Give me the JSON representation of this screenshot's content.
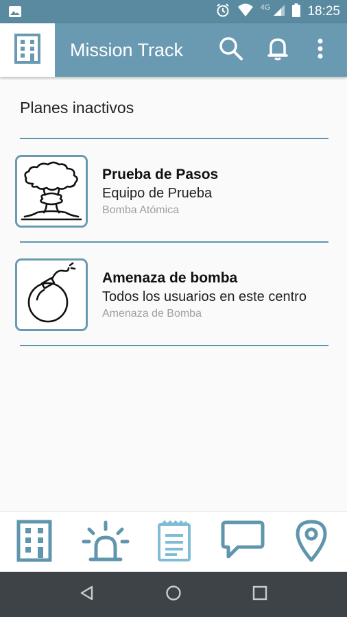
{
  "status_bar": {
    "time": "18:25",
    "network": "4G",
    "icons": [
      "image-notification-icon",
      "alarm-icon",
      "wifi-icon",
      "signal-icon",
      "battery-icon"
    ]
  },
  "app_bar": {
    "title": "Mission Track",
    "logo_icon": "building-icon",
    "actions": [
      "search-icon",
      "bell-icon",
      "more-vert-icon"
    ],
    "background": "#6a9ab2"
  },
  "section": {
    "title": "Planes inactivos"
  },
  "plans": [
    {
      "name": "Prueba de Pasos",
      "team": "Equipo de Prueba",
      "type": "Bomba Atómica",
      "icon": "nuclear-explosion-icon"
    },
    {
      "name": "Amenaza de bomba",
      "team": "Todos los usuarios en este centro",
      "type": "Amenaza de Bomba",
      "icon": "bomb-icon"
    }
  ],
  "bottom_nav": {
    "items": [
      "building-icon",
      "alarm-light-icon",
      "clipboard-icon",
      "chat-icon",
      "location-pin-icon"
    ],
    "active_color": "#7fbcd6",
    "inactive_color": "#5f96ad"
  },
  "system_nav": [
    "back-icon",
    "home-icon",
    "recents-icon"
  ]
}
